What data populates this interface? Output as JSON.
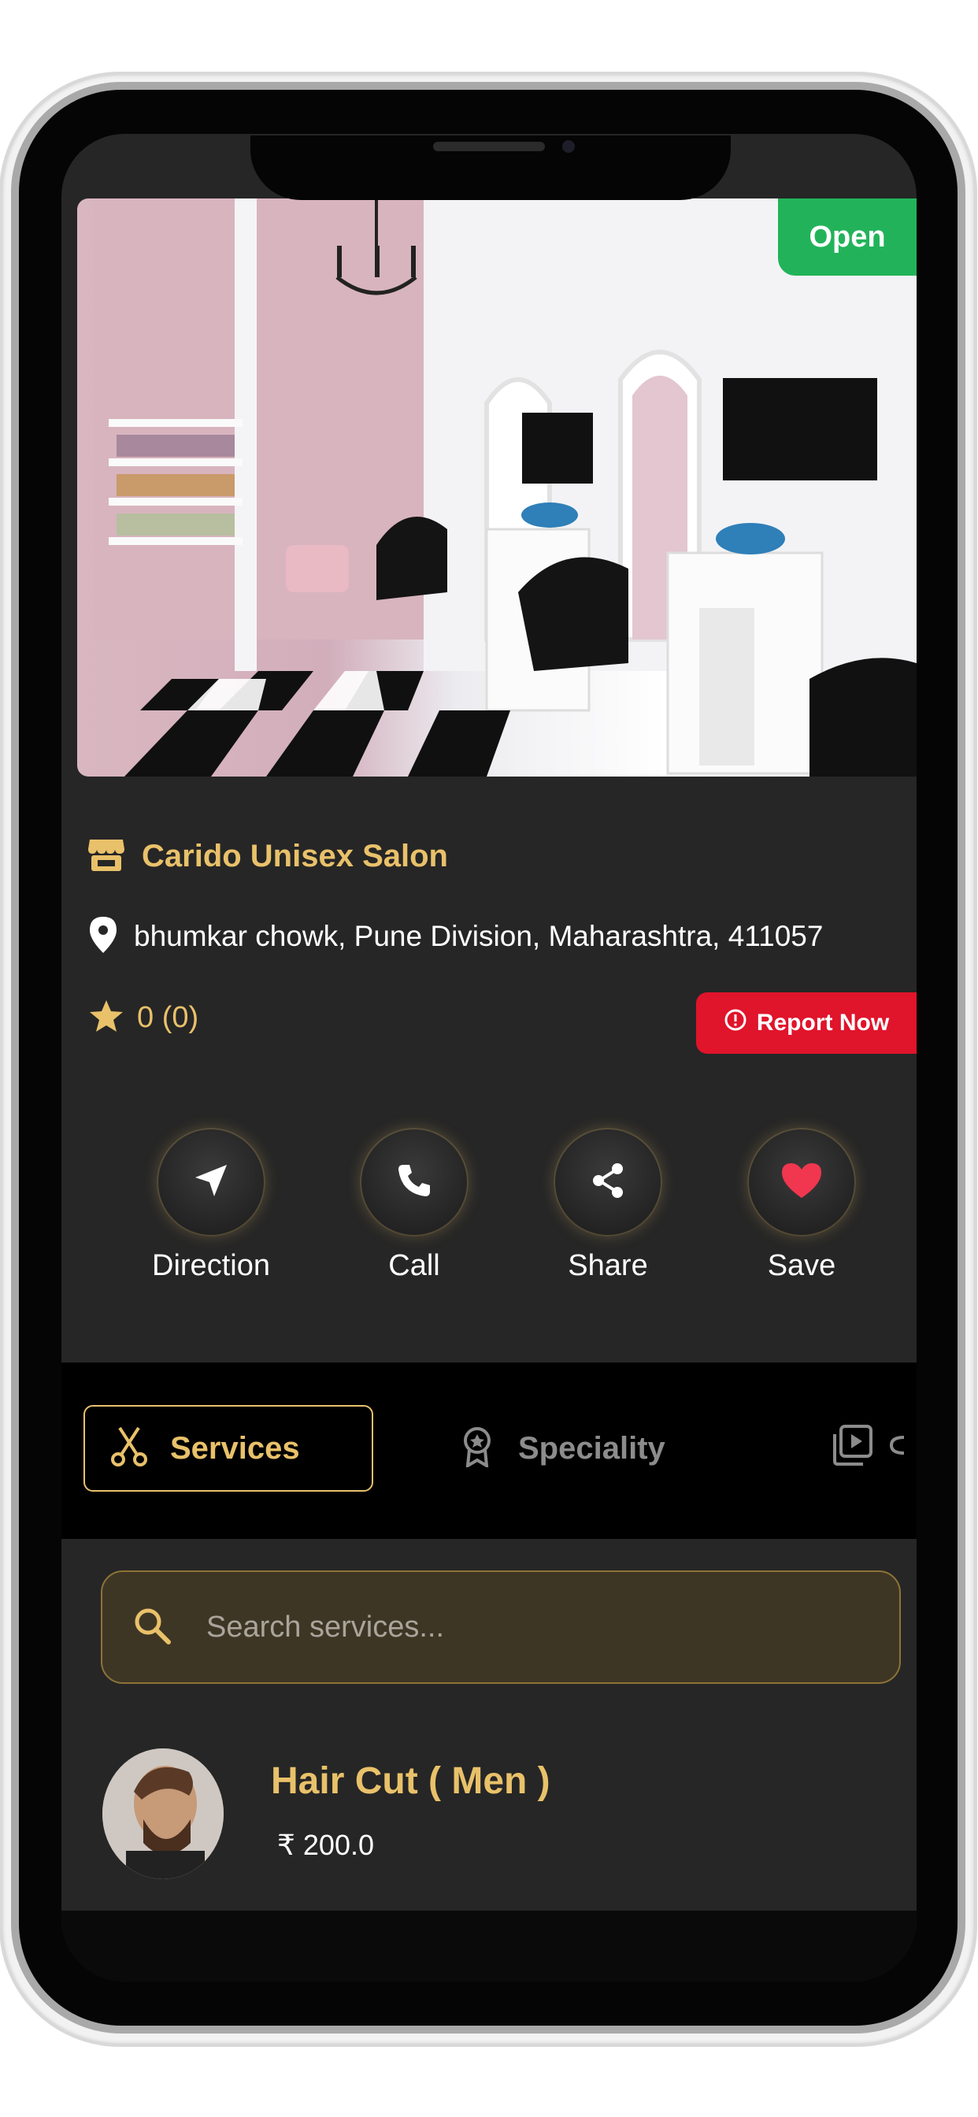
{
  "status_badge": "Open",
  "salon": {
    "name": "Carido Unisex Salon",
    "address": "bhumkar chowk, Pune Division, Maharashtra, 411057",
    "rating_text": "0 (0)",
    "store_icon": "store-icon",
    "location_icon": "map-pin-icon",
    "star_icon": "star-icon"
  },
  "report_button": {
    "label": "Report Now",
    "icon": "alert-circle-icon"
  },
  "actions": [
    {
      "label": "Direction",
      "icon": "navigation-arrow-icon"
    },
    {
      "label": "Call",
      "icon": "phone-icon"
    },
    {
      "label": "Share",
      "icon": "share-icon"
    },
    {
      "label": "Save",
      "icon": "heart-icon"
    }
  ],
  "tabs": [
    {
      "label": "Services",
      "icon": "scissors-icon",
      "active": true
    },
    {
      "label": "Speciality",
      "icon": "award-badge-icon",
      "active": false
    },
    {
      "label": "",
      "icon": "gallery-play-icon",
      "active": false
    }
  ],
  "search": {
    "placeholder": "Search services...",
    "icon": "search-icon"
  },
  "services": [
    {
      "name": "Hair Cut ( Men )",
      "price": "₹ 200.0"
    }
  ],
  "colors": {
    "gold": "#e9c16a",
    "background": "#262626",
    "open_green": "#22b35a",
    "report_red": "#e0142b",
    "heart": "#f0374f"
  }
}
